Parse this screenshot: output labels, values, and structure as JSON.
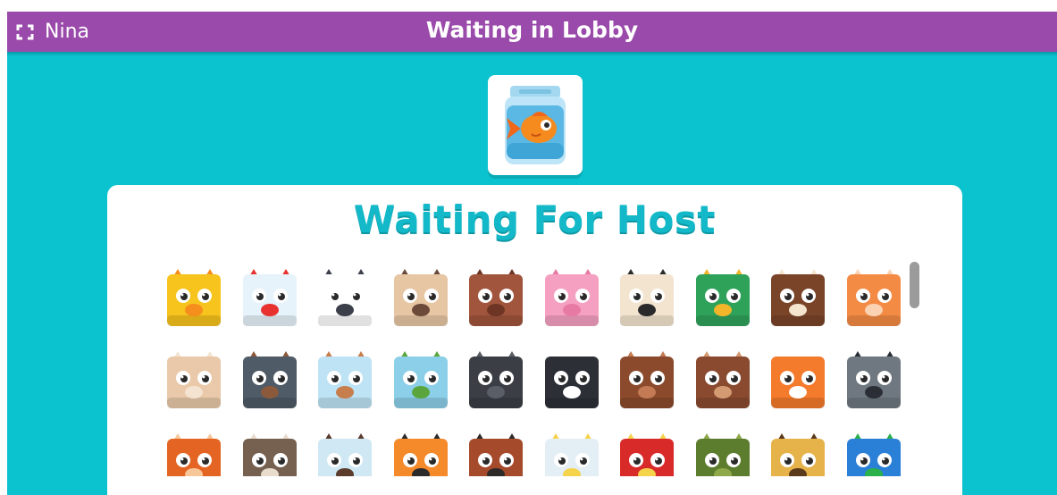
{
  "topbar": {
    "player_name": "Nina",
    "title": "Waiting in Lobby",
    "color": "#9a4aaa"
  },
  "background_color": "#0bc2cf",
  "host_blook": {
    "name": "goldfish",
    "icon": "goldfish-in-jar-icon"
  },
  "panel": {
    "title": "Waiting For Host",
    "title_color": "#13b9c8"
  },
  "blooks": [
    [
      {
        "name": "chick",
        "body": "#f7c31d",
        "accent": "#f58e1d"
      },
      {
        "name": "chicken",
        "body": "#e6f3fb",
        "accent": "#e8322f"
      },
      {
        "name": "cow",
        "body": "#ffffff",
        "accent": "#3a3f4a"
      },
      {
        "name": "goat",
        "body": "#e7c6a3",
        "accent": "#6b4a3a"
      },
      {
        "name": "horse",
        "body": "#a0553c",
        "accent": "#6e3524"
      },
      {
        "name": "pig",
        "body": "#f5a0c1",
        "accent": "#e77aa5"
      },
      {
        "name": "sheep",
        "body": "#f3e4cf",
        "accent": "#2a2a2a"
      },
      {
        "name": "duck",
        "body": "#2fa25a",
        "accent": "#f3b52a"
      },
      {
        "name": "dog",
        "body": "#7a4429",
        "accent": "#f5e5cf"
      },
      {
        "name": "cat",
        "body": "#f48b45",
        "accent": "#fbd3b3"
      }
    ],
    [
      {
        "name": "bunny",
        "body": "#e9c9a9",
        "accent": "#f5e3d1"
      },
      {
        "name": "logo",
        "body": "#4f5b66",
        "accent": "#8b5a3c"
      },
      {
        "name": "hamster",
        "body": "#bde3f4",
        "accent": "#c77d4c"
      },
      {
        "name": "turtle",
        "body": "#8ccfe9",
        "accent": "#5aa63c"
      },
      {
        "name": "black-cat",
        "body": "#3b3e45",
        "accent": "#5a5e66"
      },
      {
        "name": "husky",
        "body": "#2c2f36",
        "accent": "#ffffff"
      },
      {
        "name": "bear",
        "body": "#8b4a2c",
        "accent": "#c37a55"
      },
      {
        "name": "moose",
        "body": "#8a4a2f",
        "accent": "#d49b73"
      },
      {
        "name": "fox",
        "body": "#f47a2c",
        "accent": "#ffffff"
      },
      {
        "name": "raccoon",
        "body": "#6f7880",
        "accent": "#2b2f35"
      }
    ],
    [
      {
        "name": "squirrel",
        "body": "#e46523",
        "accent": "#f7c79a"
      },
      {
        "name": "owl",
        "body": "#76604f",
        "accent": "#e9dccd"
      },
      {
        "name": "hedgehog",
        "body": "#cfe8f3",
        "accent": "#5a3b2c"
      },
      {
        "name": "tiger",
        "body": "#f58a2b",
        "accent": "#2b2b2b"
      },
      {
        "name": "orangutan",
        "body": "#a54a2a",
        "accent": "#2e2a2a"
      },
      {
        "name": "cockatoo",
        "body": "#e4eef5",
        "accent": "#f5d34a"
      },
      {
        "name": "parrot",
        "body": "#d92a2a",
        "accent": "#f5d34a"
      },
      {
        "name": "anaconda",
        "body": "#5d7d2e",
        "accent": "#8fa84a"
      },
      {
        "name": "jaguar",
        "body": "#e6b24a",
        "accent": "#5a3a1a"
      },
      {
        "name": "macaw",
        "body": "#2a7fd6",
        "accent": "#2bb04a"
      }
    ]
  ]
}
